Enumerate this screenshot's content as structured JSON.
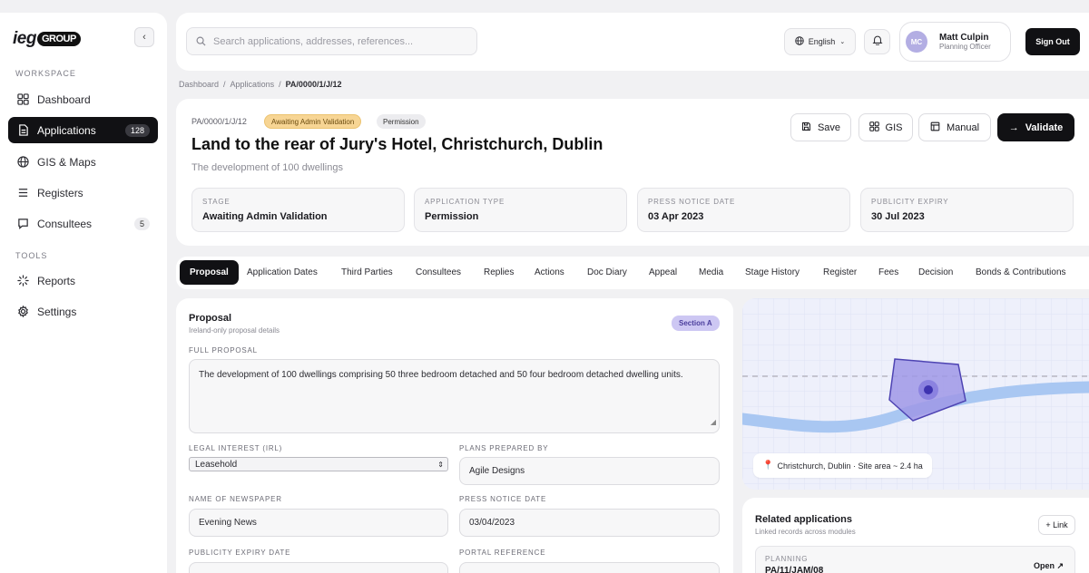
{
  "sidebar": {
    "logo_main": "ieg",
    "logo_badge": "GROUP",
    "workspace_label": "WORKSPACE",
    "tools_label": "TOOLS",
    "items": [
      {
        "label": "Dashboard",
        "icon": "dashboard-icon"
      },
      {
        "label": "Applications",
        "icon": "file-icon",
        "count": "128"
      },
      {
        "label": "GIS & Maps",
        "icon": "globe-icon"
      },
      {
        "label": "Registers",
        "icon": "list-icon"
      },
      {
        "label": "Consultees",
        "icon": "chat-icon",
        "count": "5"
      }
    ],
    "tools": [
      {
        "label": "Reports",
        "icon": "spinner-icon"
      },
      {
        "label": "Settings",
        "icon": "gear-icon"
      }
    ]
  },
  "topbar": {
    "search_placeholder": "Search applications, addresses, references...",
    "language": "English",
    "user_initials": "MC",
    "user_name": "Matt Culpin",
    "user_role": "Planning Officer",
    "signout": "Sign Out"
  },
  "breadcrumb": [
    "Dashboard",
    "Applications",
    "PA/0000/1/J/12"
  ],
  "header": {
    "ref": "PA/0000/1/J/12",
    "status_badge": "Awaiting Admin Validation",
    "type_badge": "Permission",
    "title": "Land to the rear of Jury's Hotel, Christchurch, Dublin",
    "subtitle": "The development of 100 dwellings",
    "buttons": {
      "save": "Save",
      "gis": "GIS",
      "manual": "Manual",
      "validate": "Validate"
    },
    "stats": [
      {
        "label": "STAGE",
        "value": "Awaiting Admin Validation"
      },
      {
        "label": "APPLICATION TYPE",
        "value": "Permission"
      },
      {
        "label": "PRESS NOTICE DATE",
        "value": "03 Apr 2023"
      },
      {
        "label": "PUBLICITY EXPIRY",
        "value": "30 Jul 2023"
      }
    ]
  },
  "tabs": [
    "Proposal",
    "Application Dates",
    "Third Parties",
    "Consultees",
    "Replies",
    "Actions",
    "Doc Diary",
    "Appeal",
    "Media",
    "Stage History",
    "Register",
    "Fees",
    "Decision",
    "Bonds & Contributions"
  ],
  "proposal": {
    "title": "Proposal",
    "subtitle": "Ireland-only proposal details",
    "section_badge": "Section A",
    "full_proposal_label": "FULL PROPOSAL",
    "full_proposal_value": "The development of 100 dwellings comprising 50 three bedroom detached and 50 four bedroom detached dwelling units.",
    "legal_interest_label": "LEGAL INTEREST (IRL)",
    "legal_interest_value": "Leasehold",
    "plans_label": "PLANS PREPARED BY",
    "plans_value": "Agile Designs",
    "newspaper_label": "NAME OF NEWSPAPER",
    "newspaper_value": "Evening News",
    "press_date_label": "PRESS NOTICE DATE",
    "press_date_value": "03/04/2023",
    "publicity_label": "PUBLICITY EXPIRY DATE",
    "portal_label": "PORTAL REFERENCE"
  },
  "map": {
    "caption": "Christchurch, Dublin · Site area ~ 2.4 ha",
    "colors": {
      "bg": "#eef0fb",
      "site": "#9f98e6",
      "road": "#a9c7f2"
    }
  },
  "related": {
    "title": "Related applications",
    "subtitle": "Linked records across modules",
    "link_label": "+ Link",
    "item_kind": "PLANNING",
    "item_ref": "PA/11/JAM/08",
    "item_open": "Open ↗"
  }
}
